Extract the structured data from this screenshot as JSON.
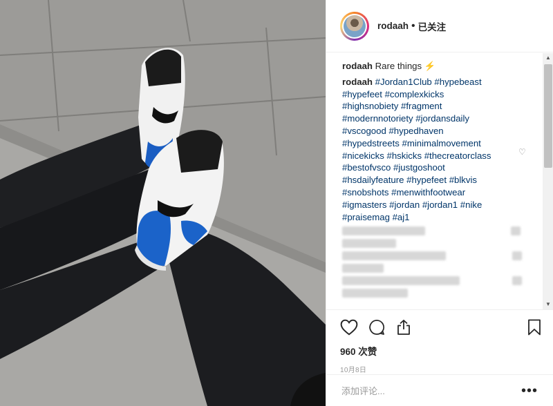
{
  "post": {
    "username": "rodaah",
    "separator": "•",
    "follow_status": "已关注"
  },
  "caption": {
    "username": "rodaah",
    "text": "Rare things ⚡"
  },
  "comment": {
    "username": "rodaah",
    "hashtags": "#Jordan1Club #hypebeast #hypefeet #complexkicks #highsnobiety #fragment #modernnotoriety #jordansdaily #vscogood #hypedhaven #hypedstreets #minimalmovement #nicekicks #hskicks #thecreatorclass #bestofvsco #justgoshoot #hsdailyfeature #hypefeet #blkvis #snobshots #menwithfootwear #igmasters #jordan #jordan1 #nike #praisemag #aj1"
  },
  "icons": {
    "like": "heart-icon",
    "comment": "comment-icon",
    "share": "share-icon",
    "save": "bookmark-icon",
    "more": "more-icon"
  },
  "likes": "960 次赞",
  "date": "10月8日",
  "add_comment_placeholder": "添加评论...",
  "more_label": "•••",
  "colors": {
    "text": "#262626",
    "hashtag": "#003569",
    "muted": "#999999",
    "border": "#efefef"
  }
}
